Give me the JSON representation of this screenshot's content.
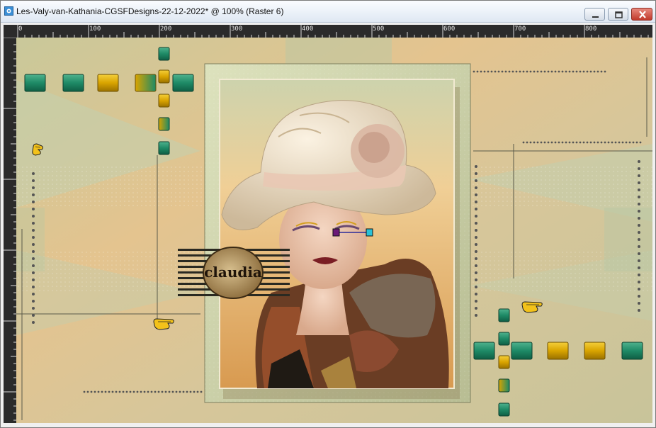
{
  "window": {
    "title": "Les-Valy-van-Kathania-CGSFDesigns-22-12-2022* @ 100% (Raster 6)"
  },
  "ruler": {
    "top_labels": [
      "0",
      "100",
      "200",
      "300",
      "400",
      "500",
      "600",
      "700",
      "800"
    ]
  },
  "canvas": {
    "watermark_text": "claudia",
    "icons": [
      "pointing-hand-icon",
      "square-tile-icon",
      "move-handle-icon"
    ],
    "colors": {
      "teal": "#1e8a66",
      "gold": "#d9a400",
      "background": "#cfc393",
      "frame": "#c5c9a0"
    }
  },
  "titlebar": {
    "icons": [
      "app-icon",
      "minimize-icon",
      "maximize-icon",
      "close-icon"
    ]
  }
}
